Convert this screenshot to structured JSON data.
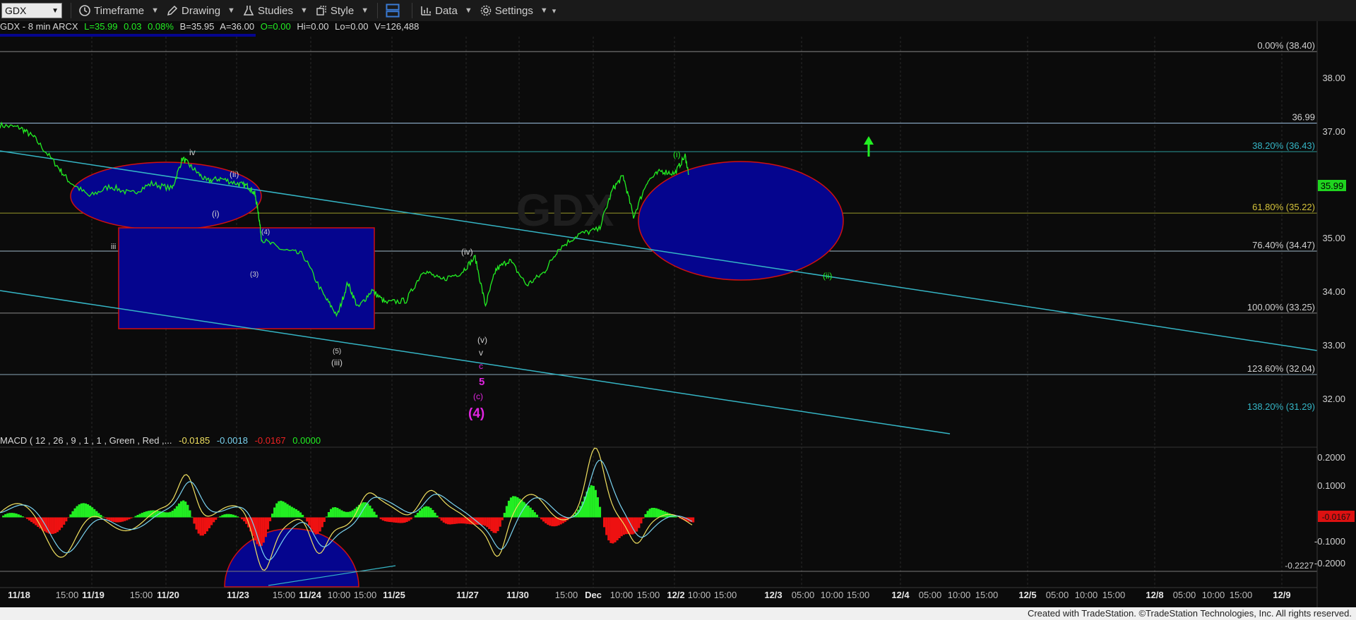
{
  "toolbar": {
    "symbol": "GDX",
    "items": [
      {
        "label": "Timeframe",
        "icon": "clock-icon"
      },
      {
        "label": "Drawing",
        "icon": "pencil-icon"
      },
      {
        "label": "Studies",
        "icon": "flask-icon"
      },
      {
        "label": "Style",
        "icon": "style-icon"
      },
      {
        "label": "Data",
        "icon": "bar-chart-icon"
      },
      {
        "label": "Settings",
        "icon": "gear-icon"
      }
    ]
  },
  "info": {
    "title": "GDX - 8 min  ARCX",
    "last": "L=35.99",
    "change": "0.03",
    "pct": "0.08%",
    "bid": "B=35.95",
    "ask": "A=36.00",
    "open": "O=0.00",
    "hi": "Hi=0.00",
    "lo": "Lo=0.00",
    "vol": "V=126,488"
  },
  "macd": {
    "title": "MACD ( 12 , 26 , 9 , 1 , 1 , Green , Red ,...",
    "v1": "-0.0185",
    "v2": "-0.0018",
    "v3": "-0.0167",
    "v4": "0.0000"
  },
  "colors": {
    "price": "#22ee22",
    "macd_line": "#f0e060",
    "signal_line": "#7ad3f0",
    "hist_up": "#22ee22",
    "hist_down": "#ee1111",
    "zone_fill": "#05058e",
    "zone_border": "#d01010",
    "channel": "#35b5c5"
  },
  "chart_data": {
    "type": "line",
    "price_axis_labels": [
      "38.00",
      "37.00",
      "35.00",
      "34.00",
      "33.00",
      "32.00"
    ],
    "current_price": "35.99",
    "price_ylim": [
      30.9,
      39.0
    ],
    "fib_levels": [
      {
        "label": "0.00% (38.40)",
        "price": 38.4
      },
      {
        "label": "36.99",
        "price": 36.99
      },
      {
        "label": "38.20% (36.43)",
        "price": 36.43
      },
      {
        "label": "61.80% (35.22)",
        "price": 35.22
      },
      {
        "label": "76.40% (34.47)",
        "price": 34.47
      },
      {
        "label": "100.00% (33.25)",
        "price": 33.25
      },
      {
        "label": "123.60% (32.04)",
        "price": 32.04
      },
      {
        "label": "138.20% (31.29)",
        "price": 31.29
      }
    ],
    "x_axis_labels": [
      "11/18",
      "15:00",
      "11/19",
      "15:00",
      "11/20",
      "11/23",
      "15:00",
      "11/24",
      "10:00",
      "15:00",
      "11/25",
      "11/27",
      "11/30",
      "15:00",
      "Dec",
      "10:00",
      "15:00",
      "12/2",
      "10:00",
      "15:00",
      "12/3",
      "05:00",
      "10:00",
      "15:00",
      "12/4",
      "05:00",
      "10:00",
      "15:00",
      "12/5",
      "05:00",
      "10:00",
      "15:00",
      "12/8",
      "05:00",
      "10:00",
      "15:00",
      "12/9"
    ],
    "wave_labels": [
      "iv",
      "(ii)",
      "(i)",
      "iii",
      "(4)",
      "(3)",
      "(5)",
      "(iii)",
      "(iv)",
      "(v)",
      "v",
      "c",
      "5",
      "(c)",
      "(4)",
      "(i)",
      "(ii)"
    ],
    "macd_axis_labels": [
      "0.2000",
      "0.1000",
      "-0.1000",
      "-0.2000",
      "-0.2227"
    ],
    "macd_current": "-0.0167",
    "macd_ylim": [
      -0.25,
      0.25
    ],
    "price_series": [
      {
        "x": 0.0,
        "y": 36.95
      },
      {
        "x": 0.03,
        "y": 36.9
      },
      {
        "x": 0.05,
        "y": 36.7
      },
      {
        "x": 0.08,
        "y": 36.2
      },
      {
        "x": 0.1,
        "y": 35.85
      },
      {
        "x": 0.13,
        "y": 35.55
      },
      {
        "x": 0.16,
        "y": 35.75
      },
      {
        "x": 0.19,
        "y": 35.6
      },
      {
        "x": 0.22,
        "y": 35.8
      },
      {
        "x": 0.25,
        "y": 35.7
      },
      {
        "x": 0.265,
        "y": 36.3
      },
      {
        "x": 0.28,
        "y": 36.1
      },
      {
        "x": 0.3,
        "y": 35.85
      },
      {
        "x": 0.32,
        "y": 35.9
      },
      {
        "x": 0.345,
        "y": 35.8
      },
      {
        "x": 0.36,
        "y": 35.75
      },
      {
        "x": 0.37,
        "y": 35.6
      },
      {
        "x": 0.375,
        "y": 35.25
      },
      {
        "x": 0.38,
        "y": 34.7
      },
      {
        "x": 0.41,
        "y": 34.5
      },
      {
        "x": 0.44,
        "y": 34.4
      },
      {
        "x": 0.47,
        "y": 33.6
      },
      {
        "x": 0.49,
        "y": 33.2
      },
      {
        "x": 0.505,
        "y": 33.85
      },
      {
        "x": 0.52,
        "y": 33.35
      },
      {
        "x": 0.54,
        "y": 33.7
      },
      {
        "x": 0.56,
        "y": 33.45
      },
      {
        "x": 0.59,
        "y": 33.5
      },
      {
        "x": 0.615,
        "y": 34.1
      },
      {
        "x": 0.64,
        "y": 33.9
      },
      {
        "x": 0.67,
        "y": 34.05
      },
      {
        "x": 0.69,
        "y": 34.35
      },
      {
        "x": 0.705,
        "y": 33.4
      },
      {
        "x": 0.72,
        "y": 34.1
      },
      {
        "x": 0.74,
        "y": 34.3
      },
      {
        "x": 0.765,
        "y": 33.8
      },
      {
        "x": 0.79,
        "y": 34.05
      },
      {
        "x": 0.81,
        "y": 34.5
      },
      {
        "x": 0.84,
        "y": 34.8
      },
      {
        "x": 0.87,
        "y": 34.9
      },
      {
        "x": 0.89,
        "y": 35.7
      },
      {
        "x": 0.905,
        "y": 35.95
      },
      {
        "x": 0.92,
        "y": 35.15
      },
      {
        "x": 0.94,
        "y": 35.85
      },
      {
        "x": 0.96,
        "y": 36.05
      },
      {
        "x": 0.98,
        "y": 36.0
      },
      {
        "x": 0.995,
        "y": 36.35
      },
      {
        "x": 1.0,
        "y": 35.99
      }
    ]
  },
  "footer": {
    "text": "Created with TradeStation. ©TradeStation Technologies, Inc. All rights reserved."
  }
}
